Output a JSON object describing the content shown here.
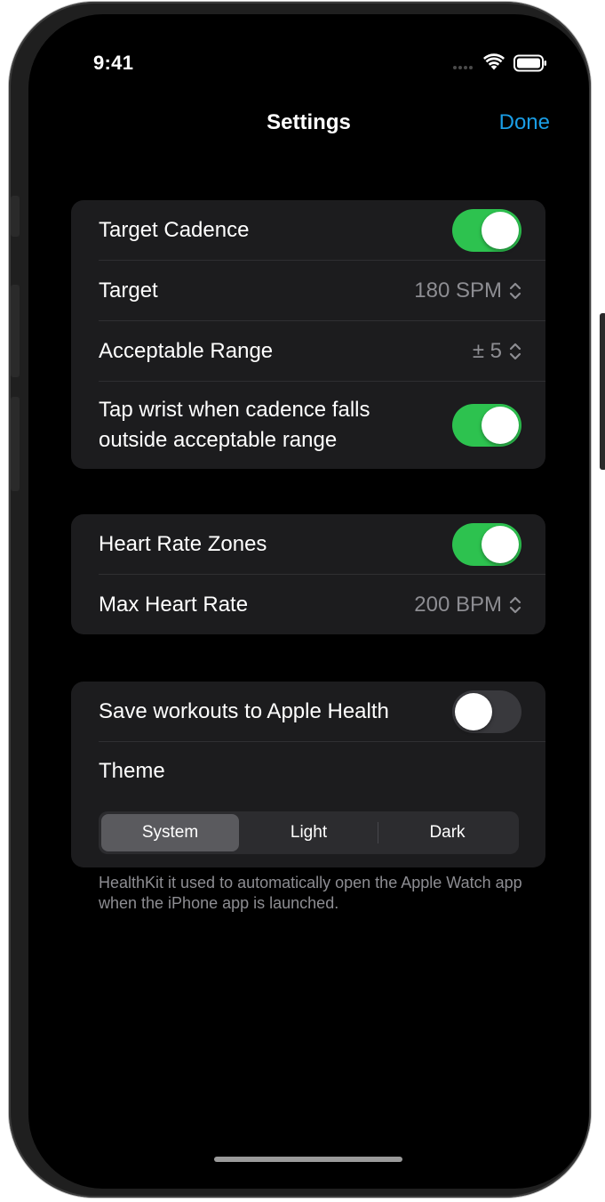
{
  "status_bar": {
    "time": "9:41"
  },
  "nav": {
    "title": "Settings",
    "done_label": "Done"
  },
  "cadence_group": {
    "target_cadence_label": "Target Cadence",
    "target_cadence_on": true,
    "target_label": "Target",
    "target_value": "180 SPM",
    "range_label": "Acceptable Range",
    "range_value": "± 5",
    "tap_wrist_label": "Tap wrist when cadence falls outside acceptable range",
    "tap_wrist_on": true
  },
  "heart_group": {
    "zones_label": "Heart Rate Zones",
    "zones_on": true,
    "max_hr_label": "Max Heart Rate",
    "max_hr_value": "200 BPM"
  },
  "health_group": {
    "save_label": "Save workouts to Apple Health",
    "save_on": false,
    "theme_label": "Theme",
    "theme_options": [
      "System",
      "Light",
      "Dark"
    ],
    "theme_selected": "System",
    "footer": "HealthKit it used to automatically open the Apple Watch app when the iPhone app is launched."
  },
  "colors": {
    "accent": "#1a9ee6",
    "toggle_on": "#2dc24f",
    "background": "#000000",
    "group_bg": "#1c1c1e"
  },
  "icons": [
    "wifi-icon",
    "battery-icon",
    "signal-icon",
    "chevron-updown-icon"
  ]
}
